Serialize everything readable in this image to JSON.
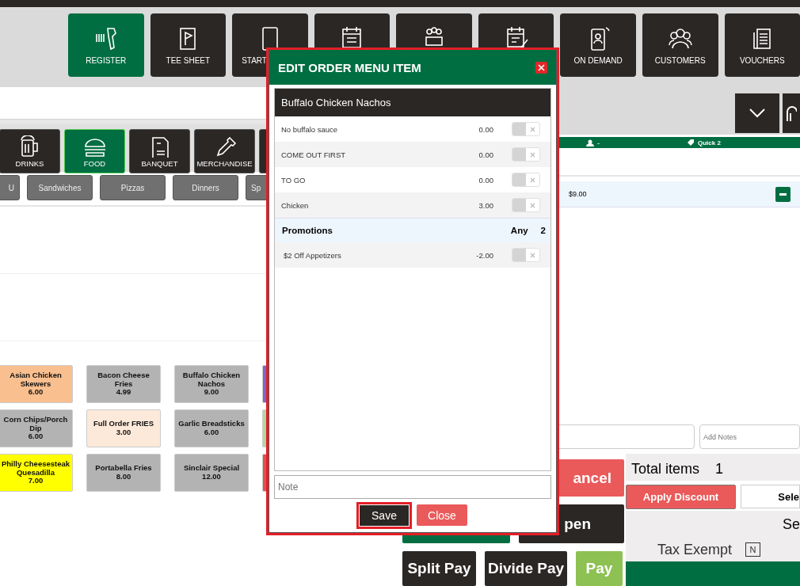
{
  "nav_tiles": [
    {
      "label": "REGISTER",
      "selected": true
    },
    {
      "label": "TEE SHEET",
      "selected": false
    },
    {
      "label": "START",
      "selected": false
    },
    {
      "selected": false
    },
    {
      "selected": false
    },
    {
      "selected": false
    },
    {
      "label": "ON DEMAND",
      "selected": false
    },
    {
      "label": "CUSTOMERS",
      "selected": false
    },
    {
      "label": "VOUCHERS",
      "selected": false
    }
  ],
  "categories": [
    {
      "label": "DRINKS",
      "selected": false
    },
    {
      "label": "FOOD",
      "selected": true
    },
    {
      "label": "BANQUET",
      "selected": false
    },
    {
      "label": "MERCHANDISE",
      "selected": false
    },
    {
      "selected": false
    }
  ],
  "subcategories": [
    "U",
    "Sandwiches",
    "Pizzas",
    "Dinners",
    "Sp"
  ],
  "menu_items": [
    {
      "name": "Asian Chicken Skewers",
      "price": "6.00",
      "color": "#f9bf8f"
    },
    {
      "name": "Bacon Cheese Fries",
      "price": "4.99",
      "color": "#b3b3b3"
    },
    {
      "name": "Buffalo Chicken Nachos",
      "price": "9.00",
      "color": "#b3b3b3"
    },
    {
      "color": "#7b68c8"
    },
    {
      "name": "Corn Chips/Porch Dip",
      "price": "6.00",
      "color": "#b3b3b3"
    },
    {
      "name": "Full Order FRIES",
      "price": "3.00",
      "color": "#fde9d9"
    },
    {
      "name": "Garlic Breadsticks",
      "price": "6.00",
      "color": "#b3b3b3"
    },
    {
      "color": "#b5d89a"
    },
    {
      "name": "Philly Cheesesteak Quesadilla",
      "price": "7.00",
      "color": "#ffff00"
    },
    {
      "name": "Portabella Fries",
      "price": "8.00",
      "color": "#b3b3b3"
    },
    {
      "name": "Sinclair Special",
      "price": "12.00",
      "color": "#b3b3b3"
    },
    {
      "color": "#e05050"
    }
  ],
  "order": {
    "customer": "-",
    "table": "Quick 2",
    "lines": [
      {
        "price": "$9.00"
      }
    ],
    "notes_placeholder": "Add Notes"
  },
  "actions": {
    "cancel": "ancel",
    "open": "pen",
    "split_pay": "Split Pay",
    "divide_pay": "Divide Pay",
    "pay": "Pay"
  },
  "summary": {
    "total_label": "Total items",
    "total_count": "1",
    "apply_discount": "Apply Discount",
    "select": "Sele",
    "label": "Se",
    "tax_exempt": "Tax Exempt",
    "tax_value": "N"
  },
  "modal": {
    "title": "EDIT ORDER MENU ITEM",
    "highlighted": true,
    "item": "Buffalo Chicken Nachos",
    "options": [
      {
        "name": "No buffalo sauce",
        "price": "0.00",
        "on": false
      },
      {
        "name": "COME OUT FIRST",
        "price": "0.00",
        "on": false
      },
      {
        "name": "TO GO",
        "price": "0.00",
        "on": false
      },
      {
        "name": "Chicken",
        "price": "3.00",
        "on": false
      }
    ],
    "promotions": {
      "label": "Promotions",
      "rule": "Any",
      "count": "2"
    },
    "promotion_items": [
      {
        "name": "$2 Off Appetizers",
        "price": "-2.00",
        "on": false
      }
    ],
    "note_placeholder": "Note",
    "save": {
      "label": "Save",
      "highlighted": true
    },
    "close": "Close"
  }
}
